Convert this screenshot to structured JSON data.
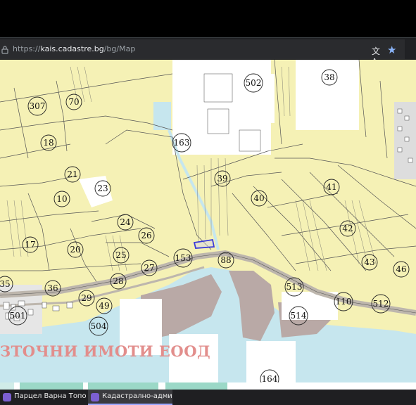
{
  "browser": {
    "url_prefix": "https://",
    "url_host": "kais.cadastre.bg",
    "url_path": "/bg/Map",
    "translate_icon": "translate-icon",
    "bookmark_icon": "star-icon"
  },
  "map": {
    "watermark": "ЗТОЧНИ ИМОТИ ЕООД",
    "labels": [
      "307",
      "70",
      "502",
      "38",
      "18",
      "163",
      "21",
      "23",
      "39",
      "41",
      "10",
      "40",
      "24",
      "42",
      "26",
      "17",
      "20",
      "25",
      "153",
      "88",
      "27",
      "43",
      "46",
      "35",
      "28",
      "513",
      "36",
      "29",
      "110",
      "512",
      "49",
      "501",
      "514",
      "504",
      "164"
    ],
    "colors": {
      "parcel": "#f5f1b5",
      "water": "#c6e6ee",
      "road": "#bdb6ad",
      "port": "#b9a9a6",
      "selected": "#3b3bd8",
      "white_area": "#ffffff"
    }
  },
  "taskbar": {
    "tabs": [
      {
        "label": "Парцел Варна Топол..."
      },
      {
        "label": "Кадастрално-админ..."
      }
    ]
  }
}
